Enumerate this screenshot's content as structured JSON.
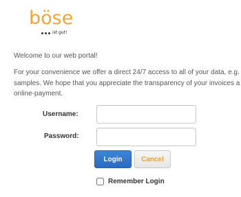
{
  "logo": {
    "wordmark": "böse",
    "tagline": "ist gut!"
  },
  "welcome": "Welcome to our web portal!",
  "intro": {
    "line1": "For your convenience we offer a direct 24/7 access to all of your data, e.g.",
    "line2": "samples. We hope that you appreciate the transparency of your invoices a",
    "line3": "online-payment."
  },
  "form": {
    "username_label": "Username:",
    "username_value": "",
    "password_label": "Password:",
    "password_value": "",
    "login_label": "Login",
    "cancel_label": "Cancel",
    "remember_label": "Remember Login",
    "remember_checked": false
  },
  "colors": {
    "brand_orange": "#f3a533",
    "login_blue": "#2a6bbf"
  }
}
